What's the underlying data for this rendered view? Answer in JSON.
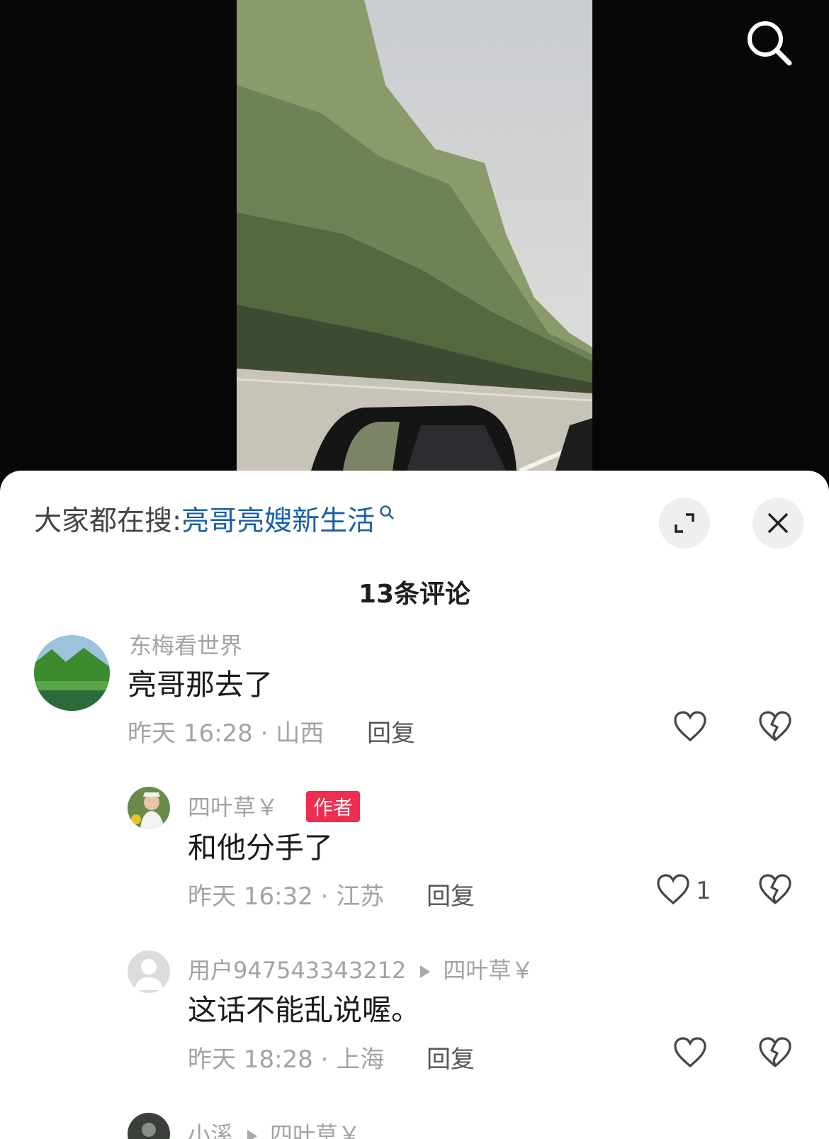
{
  "header": {
    "search_icon": "search-icon"
  },
  "hot_search": {
    "label": "大家都在搜:",
    "keyword": "亮哥亮嫂新生活"
  },
  "comments_header": {
    "count_label": "13条评论"
  },
  "comments": [
    {
      "user": "东梅看世界",
      "text": "亮哥那去了",
      "meta": "昨天 16:28 · 山西",
      "reply": "回复"
    },
    {
      "user": "四叶草￥",
      "badge": "作者",
      "text": "和他分手了",
      "meta": "昨天 16:32 · 江苏",
      "reply": "回复",
      "likes": "1"
    },
    {
      "user": "用户947543343212",
      "reply_to": "四叶草￥",
      "text": "这话不能乱说喔。",
      "meta": "昨天 18:28 · 上海",
      "reply": "回复"
    },
    {
      "user": "小溪",
      "reply_to": "四叶草￥"
    }
  ],
  "colors": {
    "keyword": "#1a5fa6",
    "badge": "#ee2d4f"
  }
}
